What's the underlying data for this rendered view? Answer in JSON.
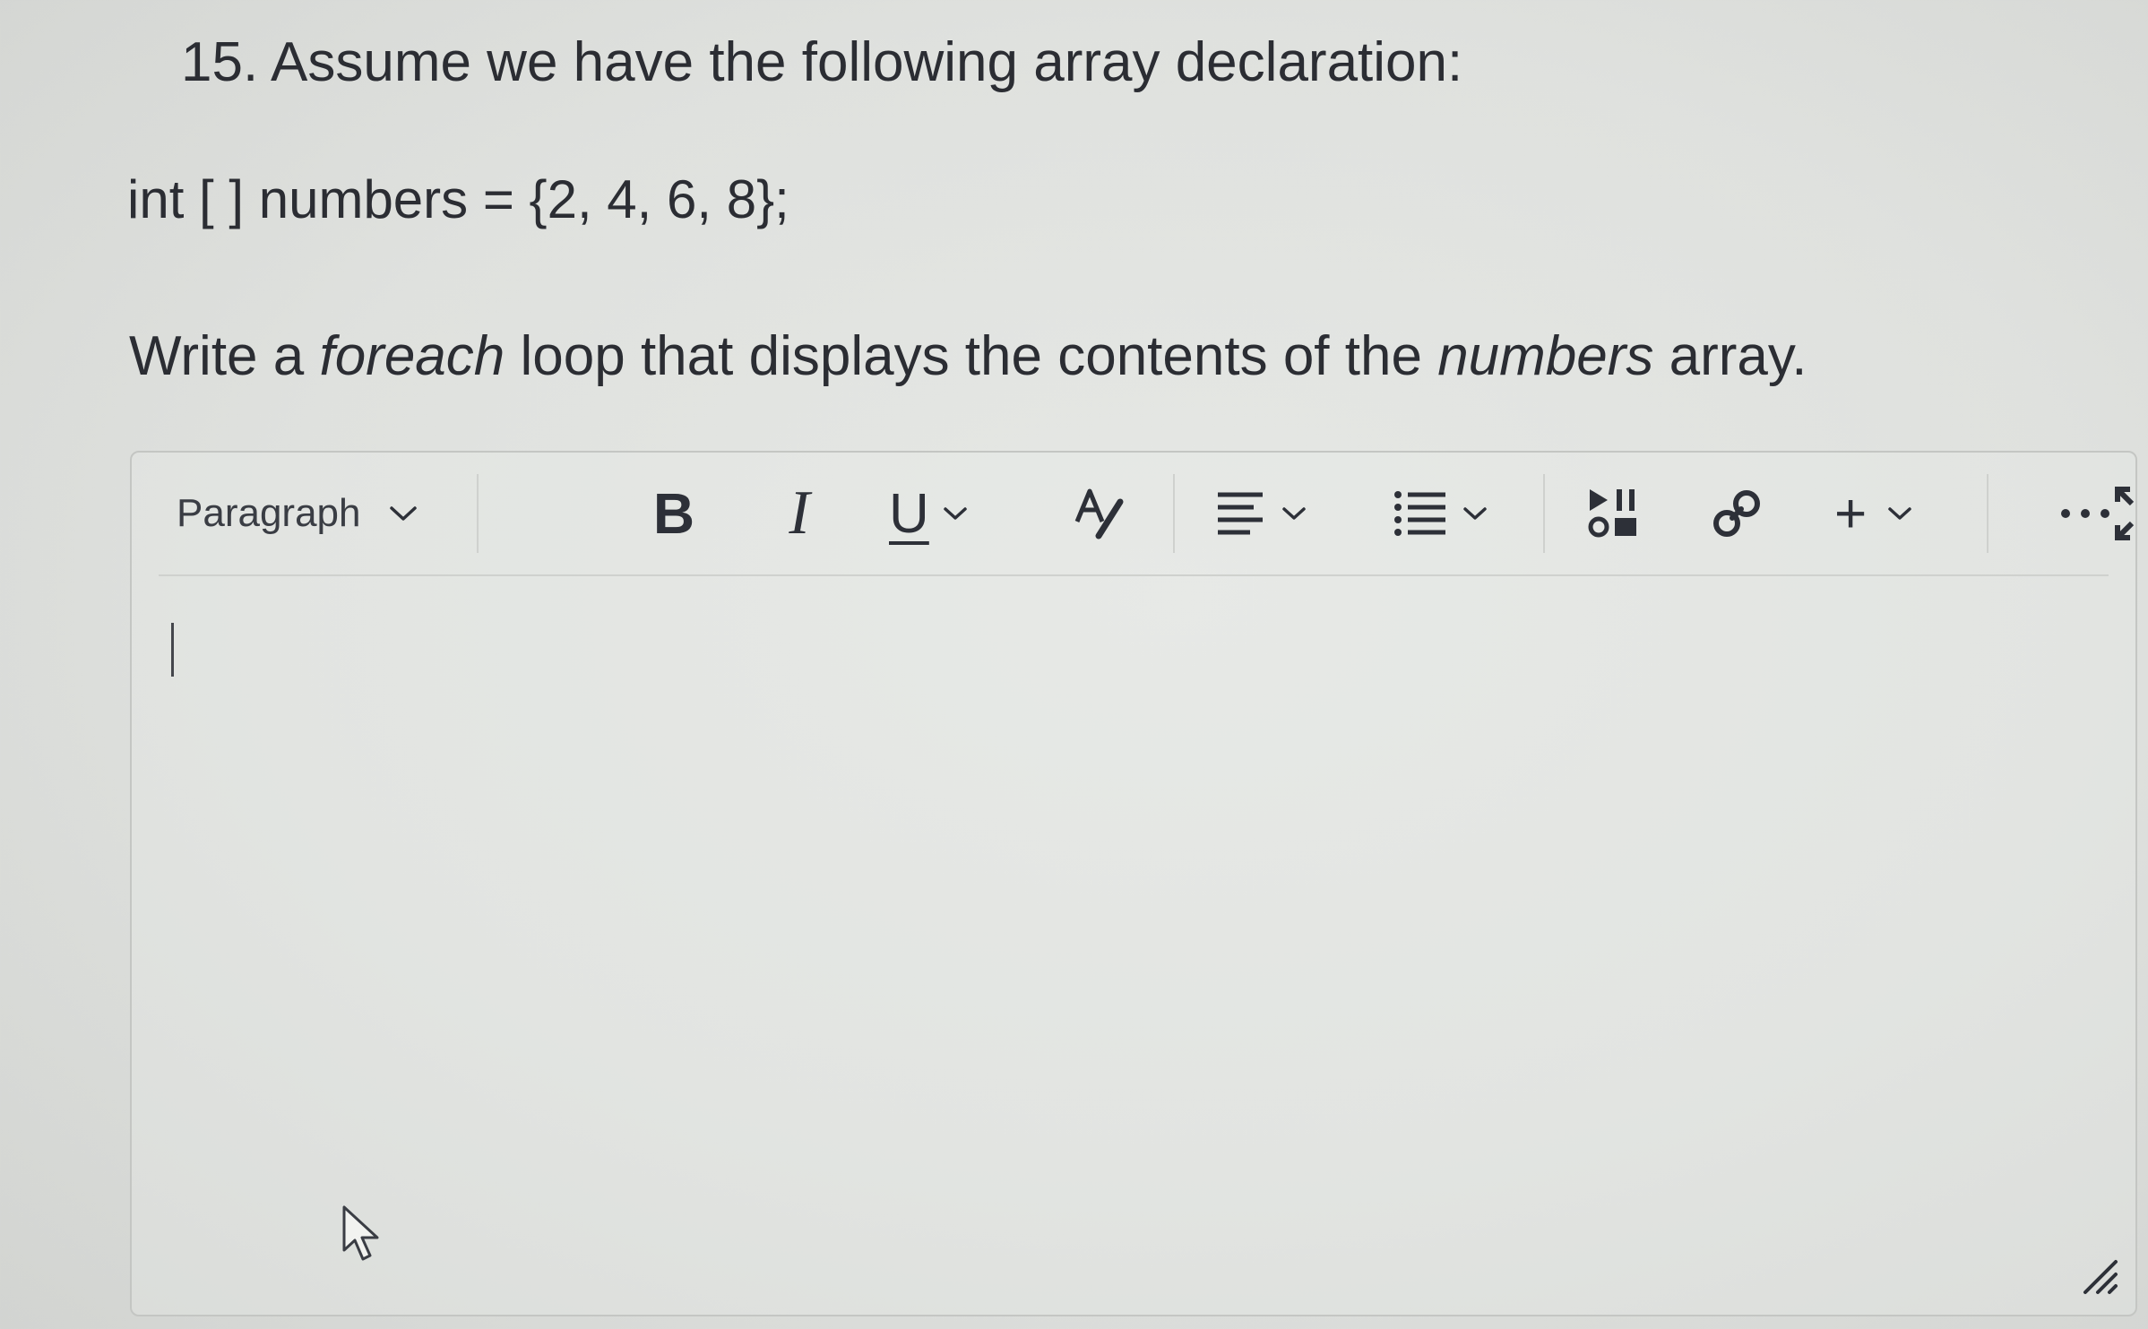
{
  "question": {
    "title": "15. Assume we have the following array declaration:",
    "code": "int [ ] numbers = {2, 4, 6, 8};",
    "prompt_pre": "Write a ",
    "prompt_em1": "foreach",
    "prompt_mid": " loop that displays the contents of the ",
    "prompt_em2": "numbers",
    "prompt_post": " array."
  },
  "editor": {
    "block_format_value": "Paragraph",
    "content": "",
    "icons": {
      "block_format_chevron": "chevron-down-icon",
      "bold": "bold-icon",
      "italic": "italic-icon",
      "underline": "underline-icon",
      "text_color": "text-color-icon",
      "align": "align-left-icon",
      "list": "bullet-list-icon",
      "media": "media-icon",
      "link": "link-icon",
      "insert": "plus-icon",
      "more": "more-options-icon",
      "fullscreen": "fullscreen-icon",
      "resize": "resize-handle-icon",
      "cursor": "mouse-pointer-icon"
    }
  }
}
